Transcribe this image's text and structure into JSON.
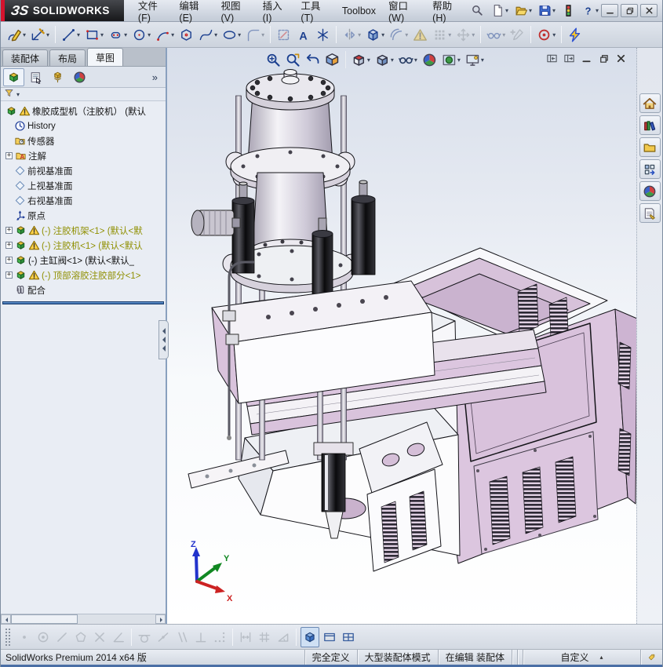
{
  "brand": {
    "mark": "ЗS",
    "name": "SOLIDWORKS"
  },
  "titlebar": {
    "menus": [
      {
        "name": "menu-file",
        "label": "文件(F)"
      },
      {
        "name": "menu-edit",
        "label": "编辑(E)"
      },
      {
        "name": "menu-view",
        "label": "视图(V)"
      },
      {
        "name": "menu-insert",
        "label": "插入(I)"
      },
      {
        "name": "menu-tools",
        "label": "工具(T)"
      },
      {
        "name": "menu-toolbox",
        "label": "Toolbox"
      },
      {
        "name": "menu-window",
        "label": "窗口(W)"
      },
      {
        "name": "menu-help",
        "label": "帮助(H)"
      }
    ],
    "search_icon": "search",
    "quick_access": [
      {
        "icon": "newdoc",
        "name": "new-document-button",
        "dd": 1
      },
      {
        "icon": "opendoc",
        "name": "open-document-button",
        "dd": 1
      },
      {
        "icon": "save",
        "name": "save-button",
        "dd": 1
      },
      {
        "icon": "traffic",
        "name": "performance-monitor-button"
      },
      {
        "icon": "helpq",
        "name": "help-button",
        "dd": 1
      }
    ],
    "window_controls": [
      {
        "icon": "wmin",
        "name": "minimize-window-button"
      },
      {
        "icon": "wrest",
        "name": "restore-window-button"
      },
      {
        "icon": "wclose",
        "name": "close-window-button"
      }
    ]
  },
  "sketch_toolbar": {
    "items": [
      {
        "icon": "pencil",
        "name": "sketch-button",
        "dd": 1
      },
      {
        "icon": "dim",
        "name": "smart-dimension-button",
        "dd": 1
      },
      {
        "sep": 1
      },
      {
        "icon": "line",
        "name": "line-tool-button",
        "dd": 1
      },
      {
        "icon": "rect",
        "name": "corner-rectangle-button",
        "dd": 1
      },
      {
        "icon": "slot",
        "name": "straight-slot-button",
        "dd": 1
      },
      {
        "icon": "circle",
        "name": "circle-tool-button",
        "dd": 1
      },
      {
        "icon": "arc",
        "name": "three-point-arc-button",
        "dd": 1
      },
      {
        "icon": "polygon",
        "name": "polygon-tool-button"
      },
      {
        "icon": "spline",
        "name": "spline-tool-button",
        "dd": 1
      },
      {
        "icon": "ellipse",
        "name": "ellipse-tool-button",
        "dd": 1
      },
      {
        "icon": "fillet",
        "name": "sketch-fillet-button",
        "dd": 1,
        "off": 1
      },
      {
        "sep": 1
      },
      {
        "icon": "trim",
        "name": "trim-entities-button",
        "off": 1
      },
      {
        "icon": "textA",
        "name": "sketch-text-button"
      },
      {
        "icon": "pointS",
        "name": "point-tool-button"
      },
      {
        "sep": 1
      },
      {
        "icon": "mirror",
        "name": "mirror-entities-button",
        "dd": 1,
        "off": 1
      },
      {
        "icon": "convert",
        "name": "convert-entities-button",
        "dd": 1
      },
      {
        "icon": "offset",
        "name": "offset-entities-button",
        "dd": 1,
        "off": 1
      },
      {
        "icon": "warn",
        "name": "sketch-error-button",
        "off": 1
      },
      {
        "icon": "pattern",
        "name": "linear-sketch-pattern-button",
        "dd": 1,
        "off": 1
      },
      {
        "icon": "move",
        "name": "move-entities-button",
        "dd": 1,
        "off": 1
      },
      {
        "sep": 1
      },
      {
        "icon": "relations",
        "name": "display-relations-button",
        "dd": 1,
        "off": 1
      },
      {
        "icon": "repair",
        "name": "repair-sketch-button",
        "off": 1
      },
      {
        "sep": 1
      },
      {
        "icon": "snaps",
        "name": "quick-snaps-button",
        "dd": 1
      },
      {
        "sep": 1
      },
      {
        "icon": "bolt",
        "name": "sketch-settings-button"
      }
    ]
  },
  "panel": {
    "tabs": [
      {
        "name": "tab-assembly",
        "label": "装配体",
        "active": false
      },
      {
        "name": "tab-layout",
        "label": "布局",
        "active": false
      },
      {
        "name": "tab-sketch",
        "label": "草图",
        "active": true
      }
    ],
    "header_buttons": [
      {
        "icon": "assembly",
        "name": "featuremanager-tab-button",
        "active": 1
      },
      {
        "icon": "pmgr",
        "name": "propertymanager-tab-button"
      },
      {
        "icon": "cmgr",
        "name": "configurationmanager-tab-button"
      },
      {
        "icon": "sphere",
        "name": "displaymanager-tab-button"
      }
    ],
    "overflow_label": "»",
    "filter_dropdown": "▾",
    "tree": [
      {
        "icons": [
          "assembly",
          "warn"
        ],
        "label": "橡胶成型机（注胶机）  (默认",
        "color": "#111111",
        "indent": 0
      },
      {
        "icons": [
          "clock"
        ],
        "label": "History",
        "indent": 1
      },
      {
        "icons": [
          "sensor"
        ],
        "label": "传感器",
        "indent": 1
      },
      {
        "expand": 1,
        "icons": [
          "anno"
        ],
        "label": "注解",
        "indent": 1
      },
      {
        "icons": [
          "plane"
        ],
        "label": "前视基准面",
        "indent": 1
      },
      {
        "icons": [
          "plane"
        ],
        "label": "上视基准面",
        "indent": 1
      },
      {
        "icons": [
          "plane"
        ],
        "label": "右视基准面",
        "indent": 1
      },
      {
        "icons": [
          "origin"
        ],
        "label": "原点",
        "indent": 1
      },
      {
        "expand": 1,
        "icons": [
          "assembly",
          "warn"
        ],
        "label": "(-) 注胶机架<1> (默认<默",
        "color": "#8f8f00",
        "indent": 1
      },
      {
        "expand": 1,
        "icons": [
          "assembly",
          "warn"
        ],
        "label": "(-) 注胶机<1> (默认<默认",
        "color": "#8f8f00",
        "indent": 1
      },
      {
        "expand": 1,
        "icons": [
          "assembly"
        ],
        "label": "(-) 主缸阀<1> (默认<默认_",
        "color": "#111111",
        "indent": 1
      },
      {
        "expand": 1,
        "icons": [
          "assembly",
          "warn"
        ],
        "label": "(-) 顶部溶胶注胶部分<1>",
        "color": "#8f8f00",
        "indent": 1
      },
      {
        "icons": [
          "mates"
        ],
        "label": "配合",
        "indent": 1
      }
    ],
    "rollback_color": "#2f5f9f"
  },
  "viewport": {
    "headsup": [
      {
        "icon": "zoomfit",
        "name": "zoom-to-fit-button"
      },
      {
        "icon": "zoomarea",
        "name": "zoom-to-area-button"
      },
      {
        "icon": "prevview",
        "name": "previous-view-button"
      },
      {
        "icon": "section",
        "name": "section-view-button"
      },
      {
        "sep": 1
      },
      {
        "icon": "orient",
        "name": "view-orientation-button",
        "dd": 1
      },
      {
        "icon": "dstyle",
        "name": "display-style-button",
        "dd": 1
      },
      {
        "icon": "glasses",
        "name": "hide-show-items-button",
        "dd": 1
      },
      {
        "icon": "sphere",
        "name": "edit-appearance-button"
      },
      {
        "icon": "scene",
        "name": "apply-scene-button",
        "dd": 1
      },
      {
        "icon": "vsettings",
        "name": "view-settings-button",
        "dd": 1
      }
    ],
    "doc_controls": [
      {
        "icon": "ptogl",
        "name": "previous-document-button"
      },
      {
        "icon": "ptogr",
        "name": "next-document-button"
      },
      {
        "icon": "wmin",
        "name": "minimize-document-button"
      },
      {
        "icon": "wrest",
        "name": "restore-document-button"
      },
      {
        "icon": "wclose",
        "name": "close-document-button"
      }
    ],
    "triad": {
      "x": "X",
      "y": "Y",
      "z": "Z",
      "x_color": "#cc2222",
      "y_color": "#118822",
      "z_color": "#2233cc"
    },
    "model_colors": {
      "panel_pink": "#dcc6df",
      "panel_pink_dark": "#cdb4d2",
      "metal_light": "#eceaf0",
      "metal_dark": "#1c1c20",
      "white_face": "#fcfcfd",
      "edge": "#15151a"
    }
  },
  "taskpane": {
    "buttons": [
      {
        "icon": "home",
        "name": "solidworks-resources-button"
      },
      {
        "icon": "dlib",
        "name": "design-library-button"
      },
      {
        "icon": "fexp",
        "name": "file-explorer-button"
      },
      {
        "icon": "vpal",
        "name": "view-palette-button"
      },
      {
        "icon": "sphere",
        "name": "appearances-scenes-button"
      },
      {
        "icon": "cprops",
        "name": "custom-properties-button"
      }
    ]
  },
  "snap_toolbar": {
    "items": [
      {
        "icon": "psnap",
        "name": "point-snap-button",
        "off": 1
      },
      {
        "icon": "conc",
        "name": "center-snap-button",
        "off": 1
      },
      {
        "icon": "lsnap",
        "name": "line-snap-button",
        "off": 1
      },
      {
        "icon": "pent",
        "name": "polygon-snap-button",
        "off": 1
      },
      {
        "icon": "inter",
        "name": "intersection-snap-button",
        "off": 1
      },
      {
        "icon": "angs",
        "name": "angle-snap-button",
        "off": 1
      },
      {
        "sep": 1
      },
      {
        "icon": "tang",
        "name": "tangent-snap-button",
        "off": 1
      },
      {
        "icon": "mids",
        "name": "midpoint-snap-button",
        "off": 1
      },
      {
        "icon": "para",
        "name": "parallel-snap-button",
        "off": 1
      },
      {
        "icon": "perp",
        "name": "perpendicular-snap-button",
        "off": 1
      },
      {
        "icon": "cdots",
        "name": "quick-snap-points-button",
        "off": 1
      },
      {
        "sep": 1
      },
      {
        "icon": "widthS",
        "name": "length-snap-button",
        "off": 1
      },
      {
        "icon": "gridS",
        "name": "grid-snap-button",
        "off": 1
      },
      {
        "icon": "angtri",
        "name": "angle-measure-button",
        "off": 1
      },
      {
        "sep": 1
      },
      {
        "icon": "cube3d",
        "name": "3d-sketch-mode-button",
        "active": 1
      },
      {
        "icon": "paneh",
        "name": "horizontal-split-view-button"
      },
      {
        "icon": "paneg",
        "name": "grid-split-view-button"
      }
    ]
  },
  "statusbar": {
    "left": "SolidWorks Premium 2014 x64 版",
    "cells": [
      "完全定义",
      "大型装配体模式",
      "在编辑  装配体"
    ],
    "custom": "自定义",
    "custom_arrow": "▴",
    "tag_icon": "tag"
  }
}
